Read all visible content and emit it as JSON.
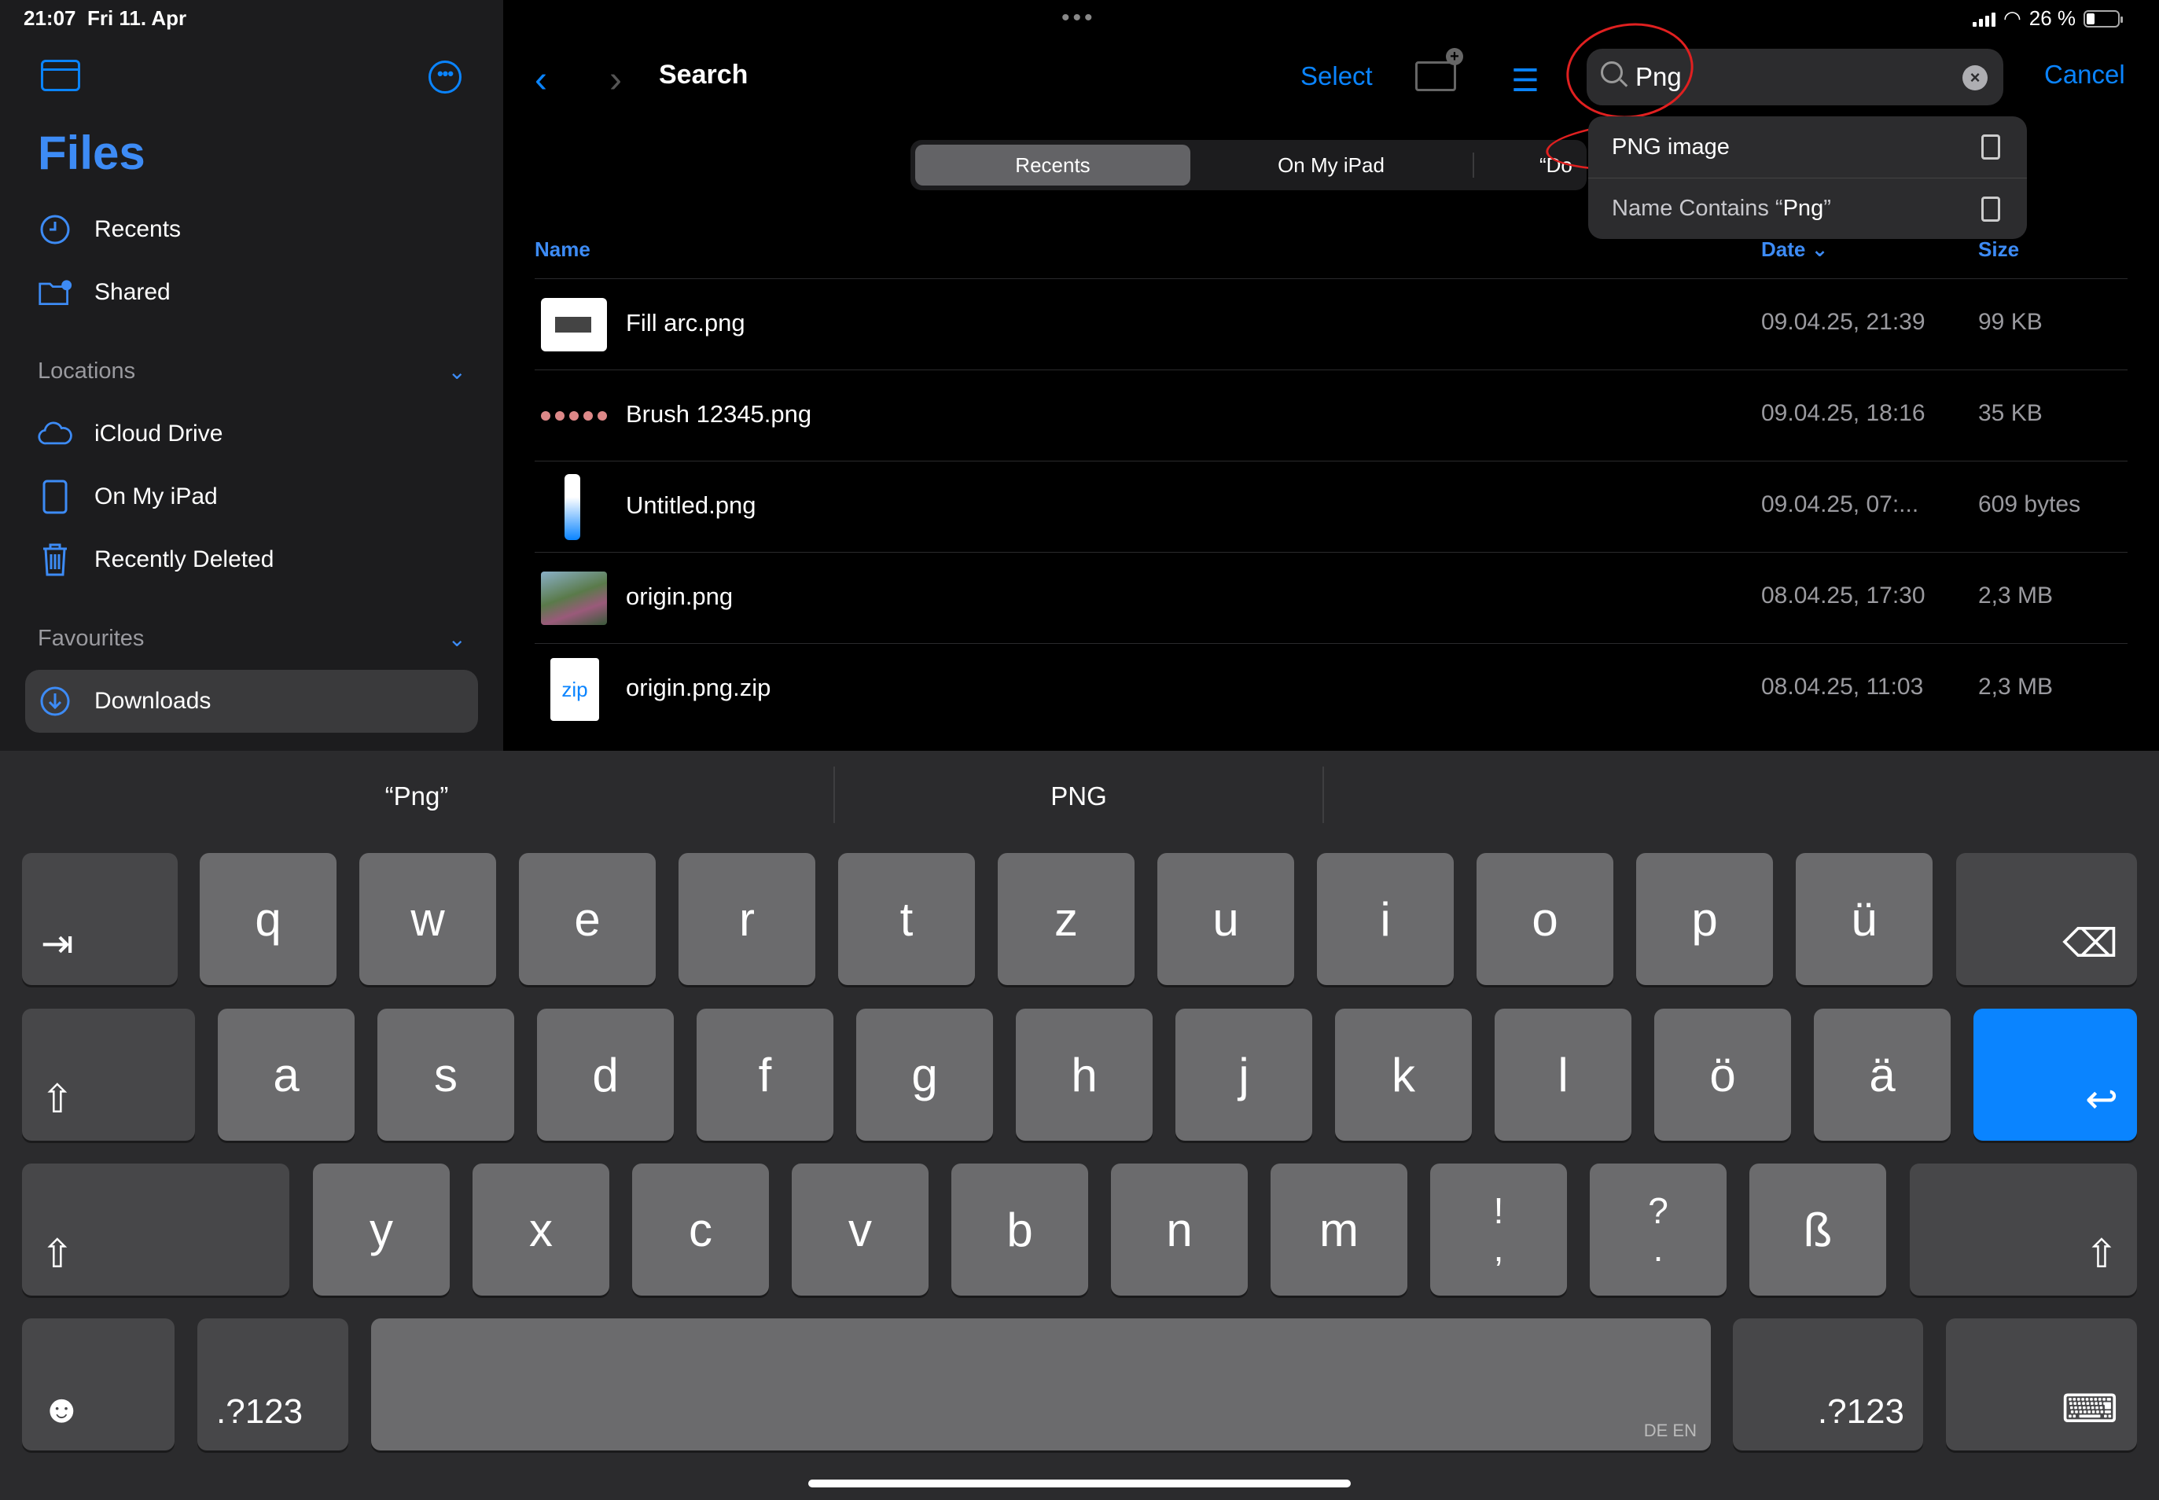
{
  "status": {
    "time": "21:07",
    "date": "Fri 11. Apr",
    "battery": "26 %",
    "multitask": "•••"
  },
  "sidebar": {
    "title": "Files",
    "items": [
      {
        "label": "Recents",
        "icon": "clock-icon"
      },
      {
        "label": "Shared",
        "icon": "shared-folder-icon"
      }
    ],
    "locations_header": "Locations",
    "locations": [
      {
        "label": "iCloud Drive",
        "icon": "cloud-icon"
      },
      {
        "label": "On My iPad",
        "icon": "ipad-icon"
      },
      {
        "label": "Recently Deleted",
        "icon": "trash-icon"
      }
    ],
    "favourites_header": "Favourites",
    "favourites": [
      {
        "label": "Downloads",
        "icon": "download-icon",
        "selected": true
      }
    ]
  },
  "header": {
    "title": "Search",
    "select": "Select",
    "cancel": "Cancel",
    "search_value": "Png"
  },
  "scopes": {
    "recents": "Recents",
    "ipad": "On My iPad",
    "other": "“Do"
  },
  "suggestions": {
    "png_image": "PNG image",
    "name_contains_prefix": "Name Contains “",
    "name_contains_term": "Png",
    "name_contains_suffix": "”"
  },
  "columns": {
    "name": "Name",
    "date": "Date",
    "size": "Size"
  },
  "files": [
    {
      "name": "Fill arc.png",
      "date": "09.04.25, 21:39",
      "size": "99 KB"
    },
    {
      "name": "Brush 12345.png",
      "date": "09.04.25, 18:16",
      "size": "35 KB"
    },
    {
      "name": "Untitled.png",
      "date": "09.04.25, 07:...",
      "size": "609 bytes"
    },
    {
      "name": "origin.png",
      "date": "08.04.25, 17:30",
      "size": "2,3 MB"
    },
    {
      "name": "origin.png.zip",
      "date": "08.04.25, 11:03",
      "size": "2,3 MB"
    }
  ],
  "zip_label": "zip",
  "predictions": [
    "“Png”",
    "PNG"
  ],
  "keys": {
    "row1": [
      "q",
      "w",
      "e",
      "r",
      "t",
      "z",
      "u",
      "i",
      "o",
      "p",
      "ü"
    ],
    "row2": [
      "a",
      "s",
      "d",
      "f",
      "g",
      "h",
      "j",
      "k",
      "l",
      "ö",
      "ä"
    ],
    "row3": [
      "y",
      "x",
      "c",
      "v",
      "b",
      "n",
      "m"
    ],
    "row3_punct": [
      [
        "!",
        ","
      ],
      [
        "?",
        "."
      ]
    ],
    "eszett": "ß",
    "numbers": ".?123",
    "lang": "DE EN",
    "tab": "⇥",
    "backspace": "⌫",
    "shift": "⇧",
    "return": "↩",
    "emoji": "☻",
    "hide_keyboard": "⌨"
  }
}
